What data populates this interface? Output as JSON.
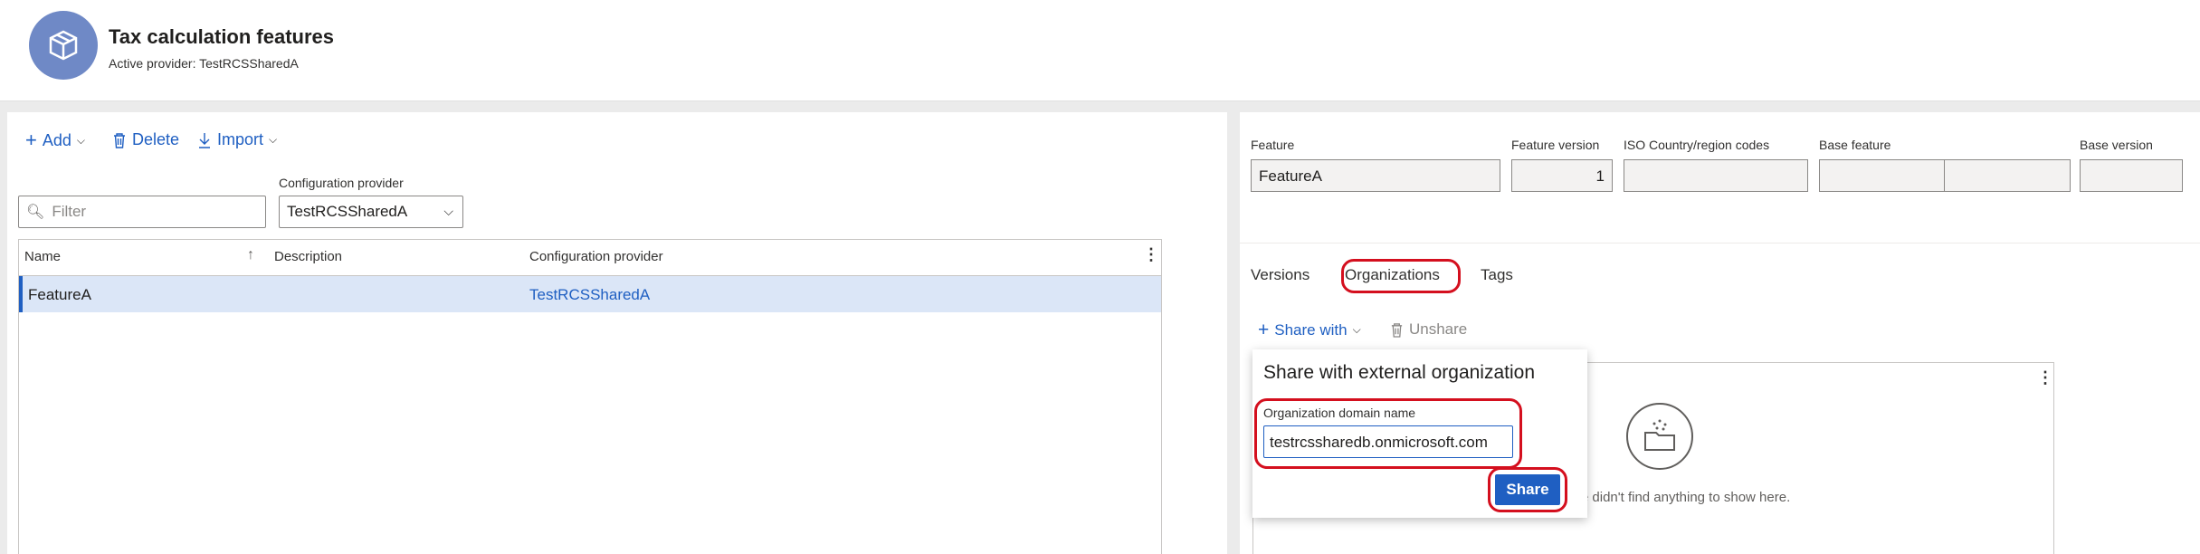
{
  "header": {
    "title": "Tax calculation features",
    "subtitle": "Active provider: TestRCSSharedA",
    "icon": "box-icon"
  },
  "toolbar": {
    "add_label": "Add",
    "delete_label": "Delete",
    "import_label": "Import"
  },
  "filter": {
    "placeholder": "Filter"
  },
  "config_provider": {
    "label": "Configuration provider",
    "value": "TestRCSSharedA"
  },
  "grid": {
    "columns": [
      "Name",
      "Description",
      "Configuration provider"
    ],
    "rows": [
      {
        "name": "FeatureA",
        "description": "",
        "provider": "TestRCSSharedA"
      }
    ]
  },
  "details": {
    "feature_label": "Feature",
    "feature_value": "FeatureA",
    "version_label": "Feature version",
    "version_value": "1",
    "iso_label": "ISO Country/region codes",
    "base_feature_label": "Base feature",
    "base_version_label": "Base version"
  },
  "tabs": [
    "Versions",
    "Organizations",
    "Tags"
  ],
  "org_toolbar": {
    "share_with_label": "Share with",
    "unshare_label": "Unshare"
  },
  "empty_state": {
    "text": "We didn't find anything to show here."
  },
  "popup": {
    "title": "Share with external organization",
    "domain_label": "Organization domain name",
    "domain_value": "testrcssharedb.onmicrosoft.com",
    "share_label": "Share"
  },
  "colors": {
    "accent": "#1f5fc2",
    "highlight": "#d40f1e",
    "avatar": "#6f89c6"
  }
}
